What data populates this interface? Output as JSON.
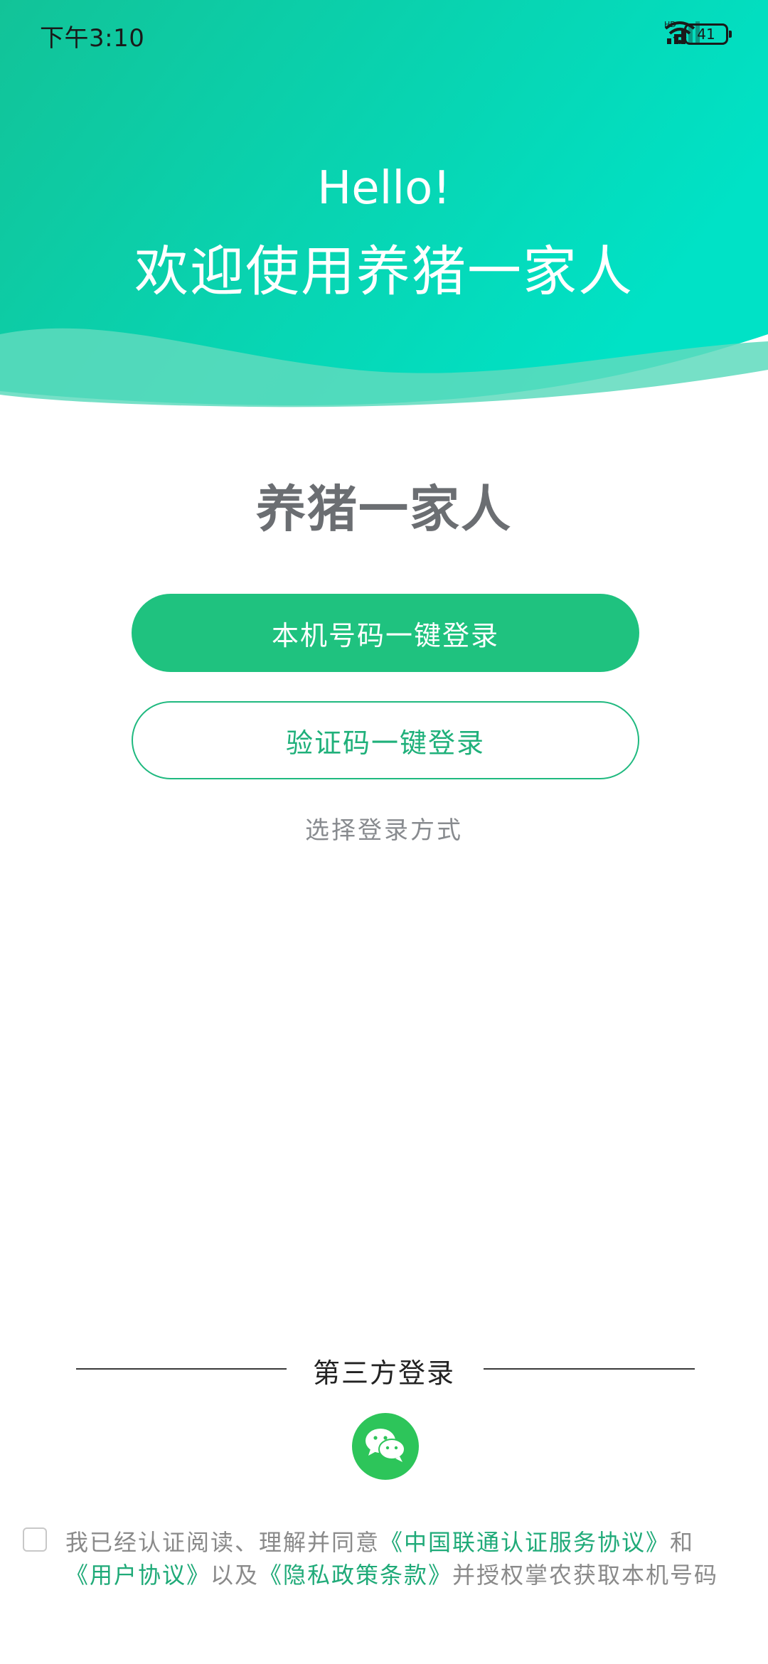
{
  "status_bar": {
    "time": "下午3:10",
    "network_label": "HD",
    "battery_level": "41",
    "icons": [
      "signal-icon",
      "wifi-icon",
      "battery-icon"
    ]
  },
  "header": {
    "greeting": "Hello!",
    "welcome": "欢迎使用养猪一家人",
    "gradient_colors": [
      "#0fc79a",
      "#00e0c2"
    ]
  },
  "main": {
    "app_name": "养猪一家人",
    "primary_button": "本机号码一键登录",
    "secondary_button": "验证码一键登录",
    "choose_method": "选择登录方式"
  },
  "third_party": {
    "title": "第三方登录",
    "wechat_icon": "wechat-icon"
  },
  "agreement": {
    "checked": false,
    "prefix": "我已经认证阅读、理解并同意",
    "link_unicom": "《中国联通认证服务协议》",
    "and": "和",
    "link_user": "《用户协议》",
    "also": "以及",
    "link_privacy": "《隐私政策条款》",
    "suffix": "并授权掌农获取本机号码"
  },
  "colors": {
    "primary": "#1fc27f",
    "link": "#1faa78",
    "wechat": "#2dc55a"
  }
}
